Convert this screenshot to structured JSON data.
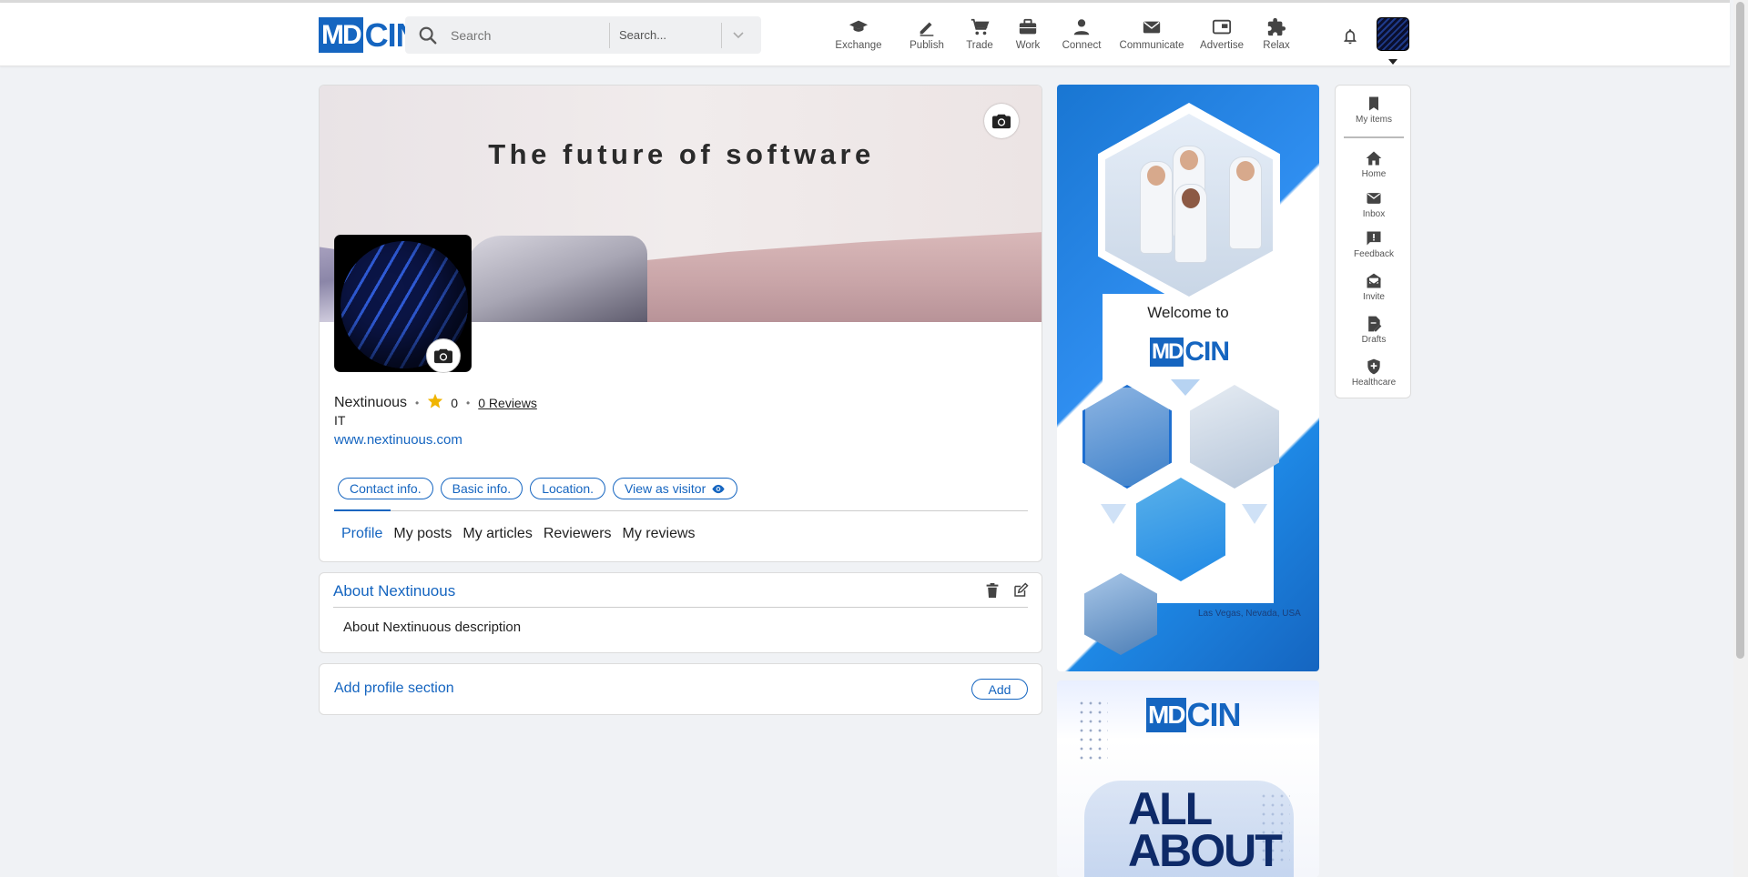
{
  "brand": {
    "logo_md": "MD",
    "logo_cin": "CIN"
  },
  "search": {
    "placeholder": "Search",
    "scope_placeholder": "Search..."
  },
  "nav": [
    {
      "label": "Exchange",
      "icon": "graduation-cap-icon"
    },
    {
      "label": "Publish",
      "icon": "pencil-icon"
    },
    {
      "label": "Trade",
      "icon": "cart-icon"
    },
    {
      "label": "Work",
      "icon": "briefcase-icon"
    },
    {
      "label": "Connect",
      "icon": "person-icon"
    },
    {
      "label": "Communicate",
      "icon": "envelope-icon"
    },
    {
      "label": "Advertise",
      "icon": "billboard-icon"
    },
    {
      "label": "Relax",
      "icon": "puzzle-icon"
    }
  ],
  "profile": {
    "cover_title": "The future of software",
    "name": "Nextinuous",
    "rating": "0",
    "reviews_link": "0 Reviews",
    "industry": "IT",
    "website": "www.nextinuous.com",
    "chips": [
      "Contact info.",
      "Basic info.",
      "Location.",
      "View as visitor"
    ],
    "tabs": [
      "Profile",
      "My posts",
      "My articles",
      "Reviewers",
      "My reviews"
    ],
    "active_tab": "Profile"
  },
  "about": {
    "title": "About Nextinuous",
    "description": "About Nextinuous description"
  },
  "add_section": {
    "title": "Add profile section",
    "button": "Add"
  },
  "ads": {
    "ad1": {
      "welcome": "Welcome to",
      "logo_md": "MD",
      "logo_cin": "CIN",
      "location": "Las Vegas, Nevada, USA"
    },
    "ad2": {
      "logo_md": "MD",
      "logo_cin": "CIN",
      "headline_1": "ALL",
      "headline_2": "ABOUT"
    }
  },
  "sidebar": [
    {
      "label": "My items",
      "icon": "bookmark-icon"
    },
    {
      "label": "Home",
      "icon": "home-icon"
    },
    {
      "label": "Inbox",
      "icon": "inbox-icon"
    },
    {
      "label": "Feedback",
      "icon": "feedback-icon"
    },
    {
      "label": "Invite",
      "icon": "invite-icon"
    },
    {
      "label": "Drafts",
      "icon": "drafts-icon"
    },
    {
      "label": "Healthcare",
      "icon": "shield-icon"
    }
  ],
  "colors": {
    "accent": "#1565c0",
    "star": "#f0b400",
    "background": "#f0f2f5"
  }
}
